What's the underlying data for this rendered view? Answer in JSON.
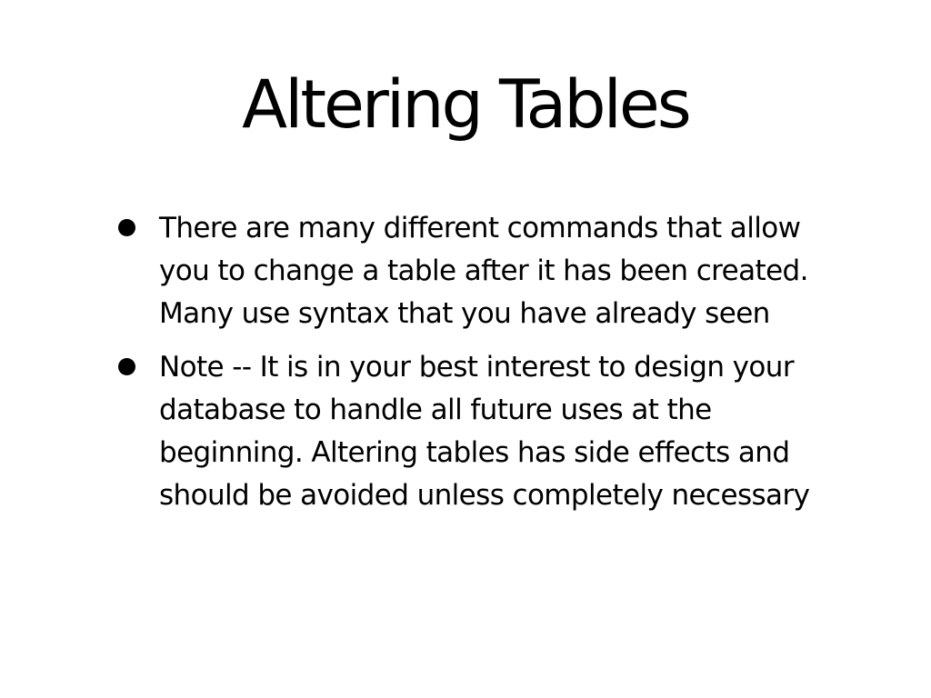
{
  "slide": {
    "title": "Altering Tables",
    "bullets": [
      "There are many different commands that allow you to change a table after it has been created. Many use syntax that you have already seen",
      "Note -- It is in your best interest to design your database to handle all future uses at the beginning. Altering tables has side effects and should be avoided unless completely necessary"
    ]
  },
  "colors": {
    "background": "#ffffff",
    "text": "#000000"
  }
}
